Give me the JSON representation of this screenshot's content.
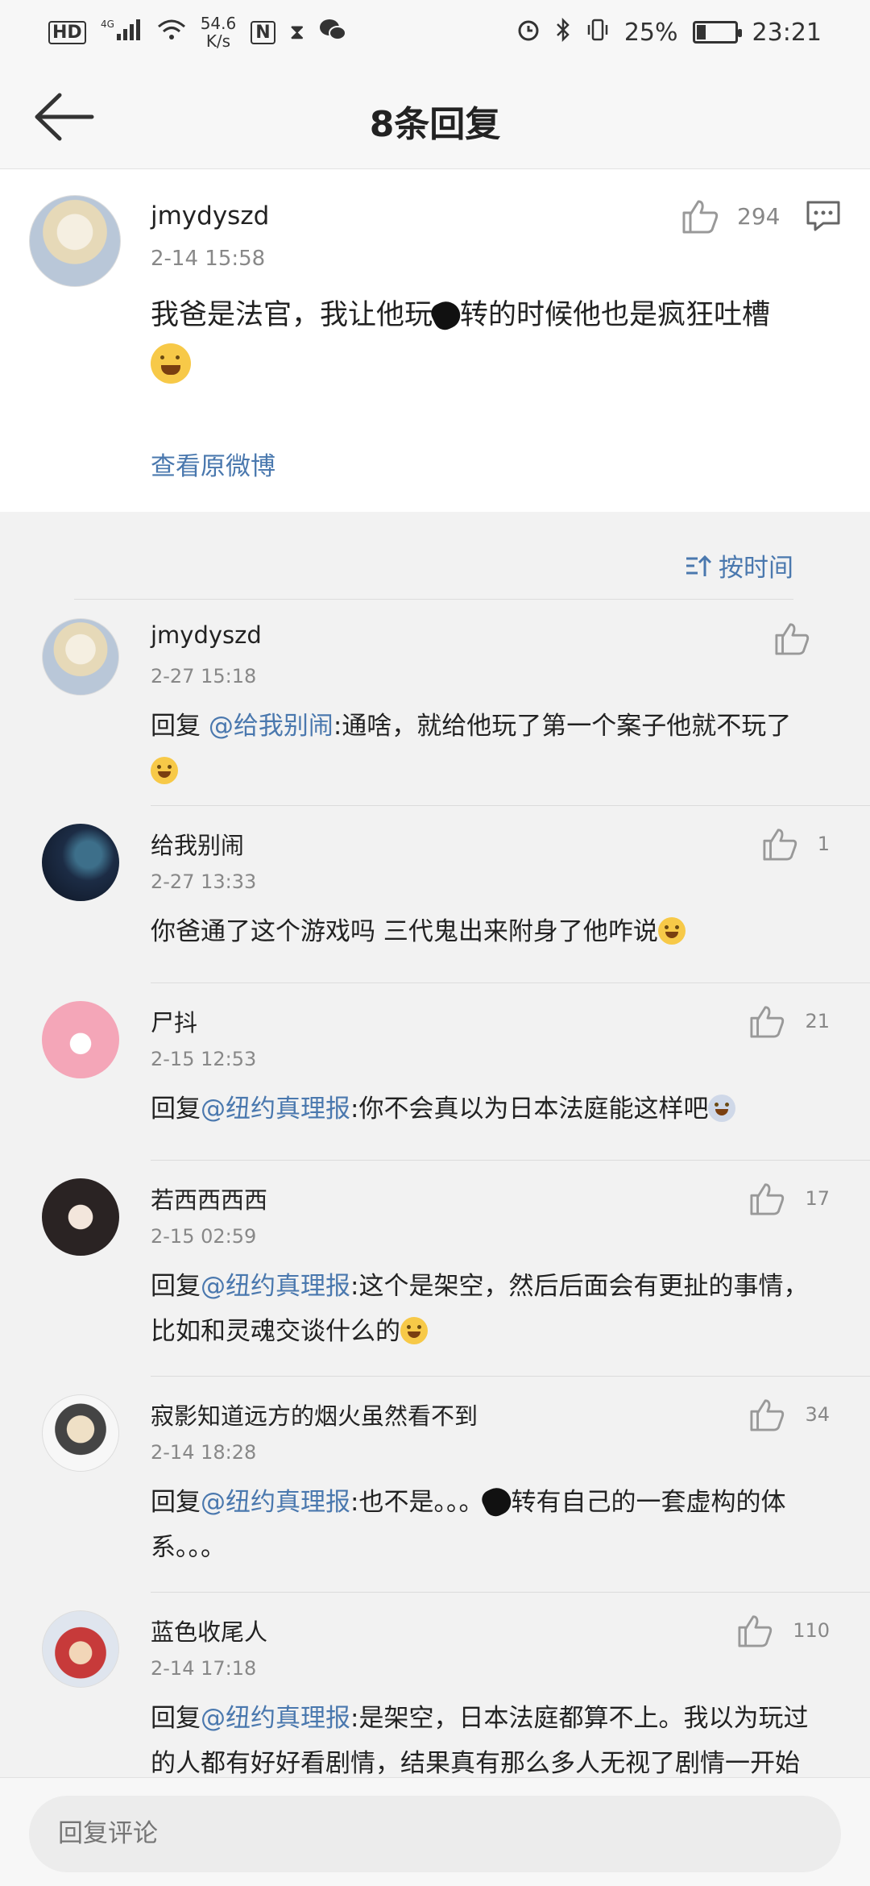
{
  "status_bar": {
    "hd": "HD",
    "network": "4G",
    "speed": "54.6",
    "speed_unit": "K/s",
    "battery": "25%",
    "battery_level": 0.25,
    "time": "23:21",
    "icons": [
      "hd-icon",
      "4g-signal-icon",
      "wifi-icon",
      "nfc-icon",
      "hourglass-icon",
      "wechat-icon",
      "alarm-icon",
      "bluetooth-icon",
      "vibrate-icon",
      "battery-icon"
    ]
  },
  "header": {
    "title": "8条回复",
    "back_icon": "back-arrow-icon"
  },
  "original_comment": {
    "username": "jmydyszd",
    "time": "2-14 15:58",
    "text_before": "我爸是法官，我让他玩",
    "text_after": "转的时候他也是疯狂吐槽",
    "likes": "294",
    "view_original": "查看原微博"
  },
  "sort": {
    "label": "按时间",
    "icon": "sort-icon"
  },
  "replies": [
    {
      "username": "jmydyszd",
      "time": "2-27 15:18",
      "prefix": "回复 ",
      "mention": "@给我别闹",
      "text": ":通啥，就给他玩了第一个案子他就不玩了",
      "likes": ""
    },
    {
      "username": "给我别闹",
      "time": "2-27 13:33",
      "prefix": "",
      "mention": "",
      "text": "你爸通了这个游戏吗 三代鬼出来附身了他咋说",
      "likes": "1"
    },
    {
      "username": "尸抖",
      "time": "2-15 12:53",
      "prefix": "回复",
      "mention": "@纽约真理报",
      "text": ":你不会真以为日本法庭能这样吧",
      "likes": "21"
    },
    {
      "username": "若西西西西",
      "time": "2-15 02:59",
      "prefix": "回复",
      "mention": "@纽约真理报",
      "text": ":这个是架空，然后后面会有更扯的事情，比如和灵魂交谈什么的",
      "likes": "17"
    },
    {
      "username": "寂影知道远方的烟火虽然看不到",
      "time": "2-14 18:28",
      "prefix": "回复",
      "mention": "@纽约真理报",
      "text": ":也不是。。。",
      "text2": "转有自己的一套虚构的体系。。。",
      "likes": "34"
    },
    {
      "username": "蓝色收尾人",
      "time": "2-14 17:18",
      "prefix": "回复",
      "mention": "@纽约真理报",
      "text": ":是架空，日本法庭都算不上。我以为玩过的人都有好好看剧情，结果真有那么多人无视了剧情一开始",
      "likes": "110"
    }
  ],
  "bottom": {
    "placeholder": "回复评论"
  }
}
